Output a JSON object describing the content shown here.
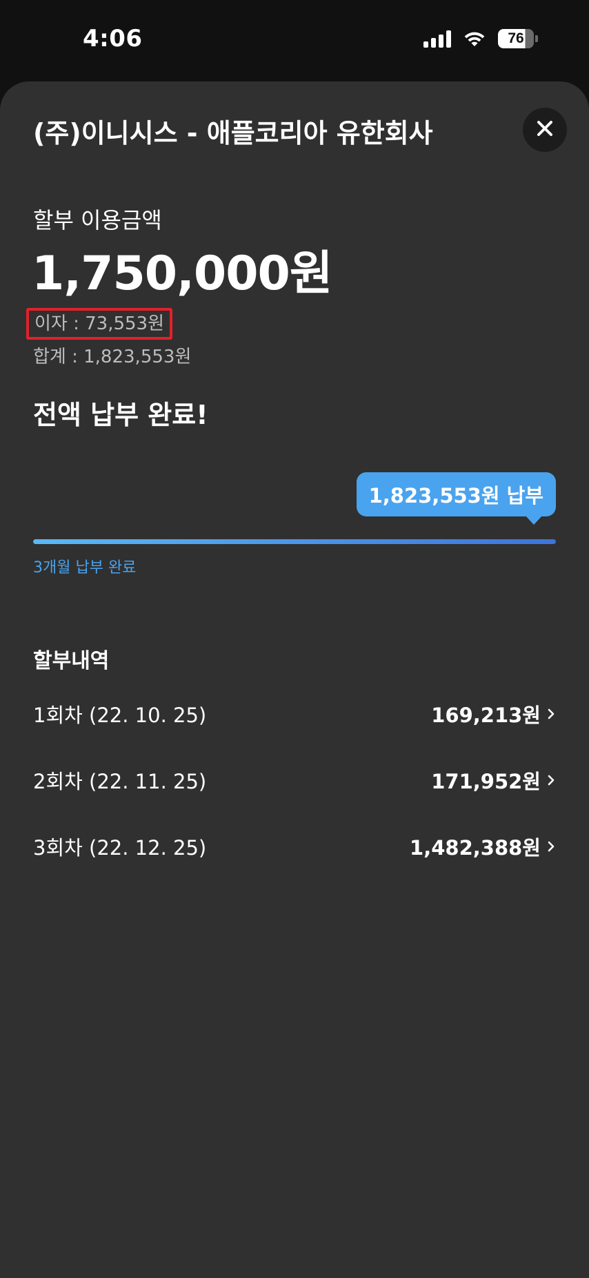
{
  "status_bar": {
    "time": "4:06",
    "battery_level": "76",
    "icons": [
      "signal-icon",
      "wifi-icon",
      "battery-icon"
    ]
  },
  "sheet": {
    "merchant": "(주)이니시스 - 애플코리아 유한회사",
    "close_icon": "close-icon",
    "amount_label": "할부 이용금액",
    "amount": "1,750,000원",
    "interest": "이자 : 73,553원",
    "total": "합계 : 1,823,553원",
    "status_title": "전액 납부 완료!",
    "paid_tooltip": "1,823,553원 납부",
    "progress_percent": 100,
    "progress_caption": "3개월 납부 완료",
    "history_title": "할부내역",
    "history": [
      {
        "date": "1회차 (22. 10. 25)",
        "amount": "169,213원"
      },
      {
        "date": "2회차 (22. 11. 25)",
        "amount": "171,952원"
      },
      {
        "date": "3회차 (22. 12. 25)",
        "amount": "1,482,388원"
      }
    ]
  },
  "colors": {
    "accent": "#4aa3ee",
    "highlight_border": "#e0222b",
    "sheet_bg": "#303030",
    "page_bg": "#111112"
  }
}
